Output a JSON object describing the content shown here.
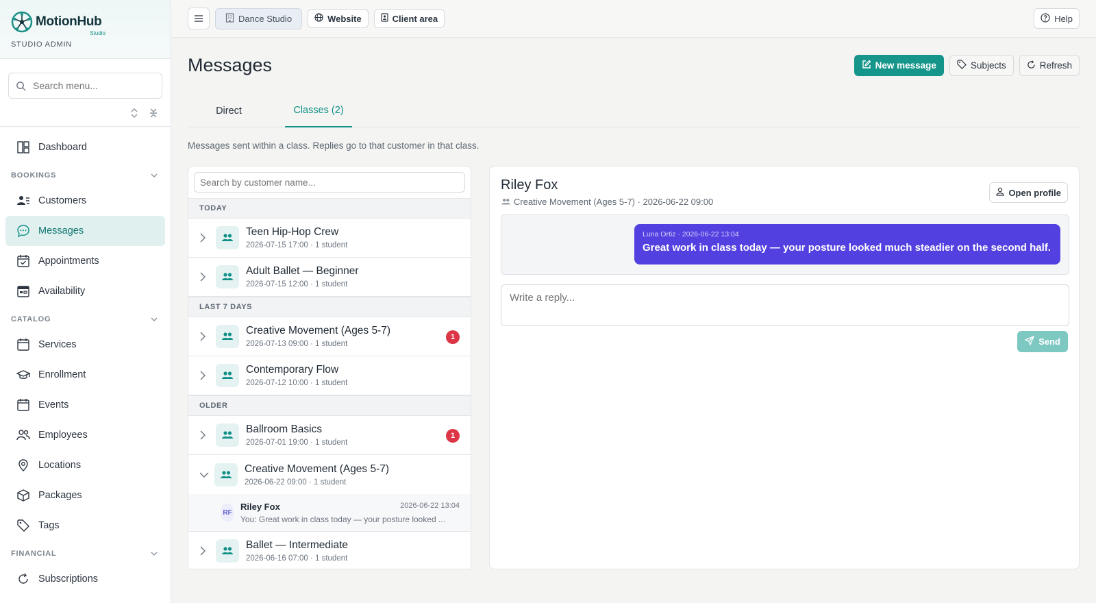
{
  "brand": {
    "name": "MotionHub",
    "sub": "Studio",
    "role": "STUDIO ADMIN"
  },
  "sidebar": {
    "search_placeholder": "Search menu...",
    "dashboard": "Dashboard",
    "sections": {
      "bookings": "BOOKINGS",
      "catalog": "CATALOG",
      "financial": "FINANCIAL"
    },
    "bookings_items": [
      {
        "label": "Customers",
        "icon": "customers-icon"
      },
      {
        "label": "Messages",
        "icon": "chat-bubble-icon"
      },
      {
        "label": "Appointments",
        "icon": "calendar-check-icon"
      },
      {
        "label": "Availability",
        "icon": "calendar-grid-icon"
      }
    ],
    "catalog_items": [
      {
        "label": "Services",
        "icon": "calendar-icon"
      },
      {
        "label": "Enrollment",
        "icon": "graduation-cap-icon"
      },
      {
        "label": "Events",
        "icon": "calendar-icon"
      },
      {
        "label": "Employees",
        "icon": "users-icon"
      },
      {
        "label": "Locations",
        "icon": "map-pin-icon"
      },
      {
        "label": "Packages",
        "icon": "box-icon"
      },
      {
        "label": "Tags",
        "icon": "tag-icon"
      }
    ],
    "financial_items": [
      {
        "label": "Subscriptions",
        "icon": "refresh-icon"
      }
    ]
  },
  "topbar": {
    "studio": "Dance Studio",
    "website": "Website",
    "client_area": "Client area",
    "help": "Help"
  },
  "page": {
    "title": "Messages",
    "new_message": "New message",
    "subjects": "Subjects",
    "refresh": "Refresh",
    "tab_direct": "Direct",
    "tab_classes": "Classes (2)",
    "hint": "Messages sent within a class. Replies go to that customer in that class."
  },
  "list": {
    "search_placeholder": "Search by customer name...",
    "groups": {
      "today": "TODAY",
      "last7": "LAST 7 DAYS",
      "older": "OLDER"
    },
    "items": [
      {
        "name": "Teen Hip-Hop Crew",
        "meta": "2026-07-15 17:00 · 1 student"
      },
      {
        "name": "Adult Ballet — Beginner",
        "meta": "2026-07-15 12:00 · 1 student"
      },
      {
        "name": "Creative Movement (Ages 5-7)",
        "meta": "2026-07-13 09:00 · 1 student",
        "badge": "1"
      },
      {
        "name": "Contemporary Flow",
        "meta": "2026-07-12 10:00 · 1 student"
      },
      {
        "name": "Ballroom Basics",
        "meta": "2026-07-01 19:00 · 1 student",
        "badge": "1"
      },
      {
        "name": "Creative Movement (Ages 5-7)",
        "meta": "2026-06-22 09:00 · 1 student"
      },
      {
        "name": "Ballet — Intermediate",
        "meta": "2026-06-16 07:00 · 1 student"
      }
    ],
    "sub": {
      "initials": "RF",
      "name": "Riley Fox",
      "time": "2026-06-22 13:04",
      "preview": "You: Great work in class today — your posture looked ..."
    }
  },
  "chat": {
    "name": "Riley Fox",
    "meta": "Creative Movement (Ages 5-7) · 2026-06-22 09:00",
    "open_profile": "Open profile",
    "message_meta": "Luna Ortiz · 2026-06-22 13:04",
    "message_text": "Great work in class today — your posture looked much steadier on the second half.",
    "reply_placeholder": "Write a reply...",
    "send": "Send"
  },
  "colors": {
    "accent": "#16958b",
    "bubble": "#5240e0",
    "badge": "#dc3545"
  }
}
